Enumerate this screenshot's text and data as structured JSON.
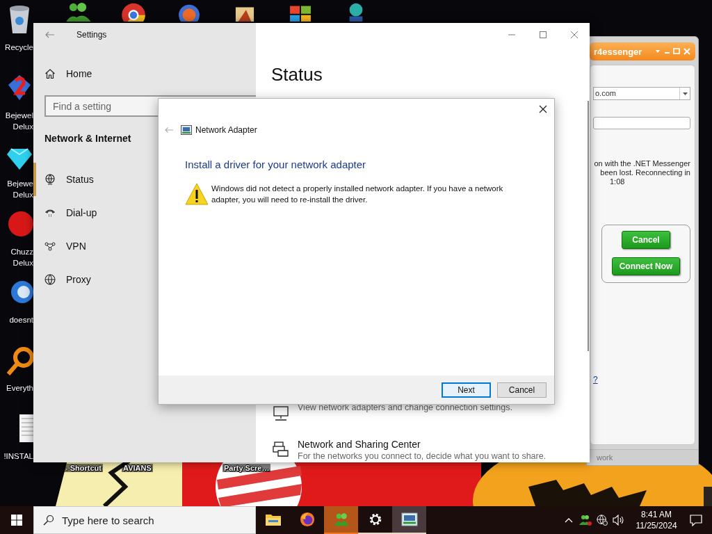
{
  "desktop_icons": [
    {
      "lines": [
        "Recycle"
      ]
    },
    {
      "lines": [
        "Bejewel",
        "Delux"
      ]
    },
    {
      "lines": [
        "Bejewe",
        "Delux"
      ]
    },
    {
      "lines": [
        "Chuzz",
        "Delux"
      ]
    },
    {
      "lines": [
        "doesnt"
      ]
    },
    {
      "lines": [
        "Everyth"
      ]
    },
    {
      "lines": [
        "!INSTAL"
      ]
    }
  ],
  "wallpaper_labels": [
    "- Shortcut",
    "AVIANS",
    "Party Scre…"
  ],
  "messenger_window": {
    "title": "r4essenger",
    "account": "o.com",
    "message_lines": [
      "on with the .NET Messenger",
      "been lost. Reconnecting in",
      "1:08"
    ],
    "buttons": [
      "Cancel",
      "Connect Now"
    ],
    "link": "?",
    "status": "work"
  },
  "settings_window": {
    "title": "Settings",
    "home": "Home",
    "search": {
      "placeholder": "Find a setting"
    },
    "section": "Network & Internet",
    "nav": [
      {
        "label": "Status",
        "selected": true
      },
      {
        "label": "Dial-up",
        "selected": false
      },
      {
        "label": "VPN",
        "selected": false
      },
      {
        "label": "Proxy",
        "selected": false
      }
    ],
    "page_title": "Status",
    "options": [
      {
        "description": "View network adapters and change connection settings."
      },
      {
        "title": "Network and Sharing Center",
        "description": "For the networks you connect to, decide what you want to share."
      }
    ]
  },
  "dialog": {
    "title": "Network Adapter",
    "heading": "Install a driver for your network adapter",
    "message": "Windows did not detect a properly installed network adapter. If you have a network adapter, you will need to re-install the driver.",
    "buttons": [
      {
        "label": "Next",
        "default": true
      },
      {
        "label": "Cancel",
        "default": false
      }
    ]
  },
  "taskbar": {
    "search": {
      "placeholder": "Type here to search"
    },
    "apps": [
      {
        "running": false,
        "attention": false,
        "selected": false
      },
      {
        "running": false,
        "attention": false,
        "selected": false
      },
      {
        "running": true,
        "attention": true,
        "selected": false
      },
      {
        "running": true,
        "attention": false,
        "selected": false
      },
      {
        "running": true,
        "attention": false,
        "selected": true
      }
    ],
    "time": "8:41 AM",
    "date": "11/25/2024"
  }
}
